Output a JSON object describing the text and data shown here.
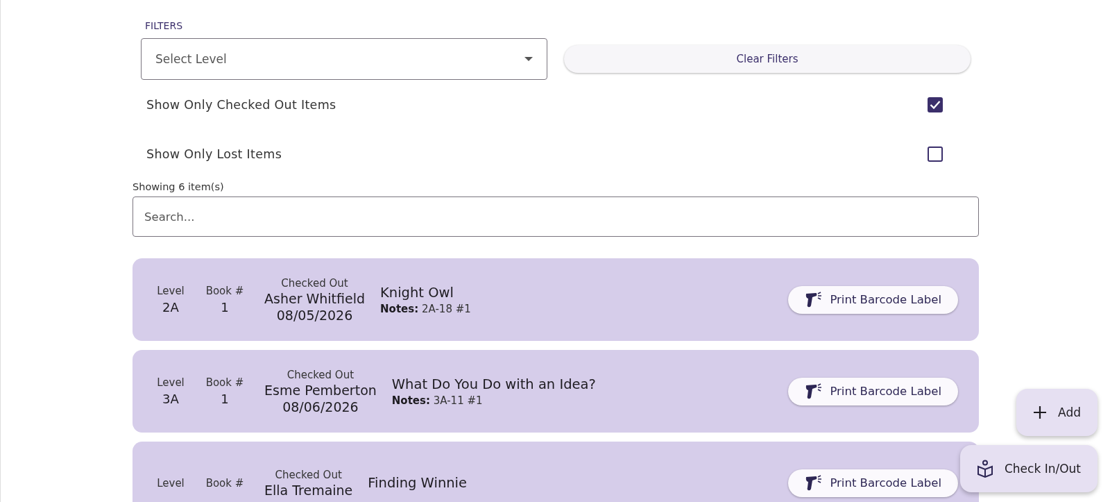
{
  "filters": {
    "heading": "FILTERS",
    "level_select": {
      "placeholder": "Select Level"
    },
    "clear_button": "Clear Filters",
    "toggles": [
      {
        "label": "Show Only Checked Out Items",
        "checked": true
      },
      {
        "label": "Show Only Lost Items",
        "checked": false
      }
    ]
  },
  "count": "Showing 6 item(s)",
  "search": {
    "placeholder": "Search..."
  },
  "items": [
    {
      "level_label": "Level",
      "level": "2A",
      "book_label": "Book #",
      "book": "1",
      "status": "Checked Out",
      "borrower": "Asher Whitfield",
      "date": "08/05/2026",
      "title": "Knight Owl",
      "notes": "**Notes:** 2A-18 #1",
      "button": "Print Barcode Label"
    },
    {
      "level_label": "Level",
      "level": "3A",
      "book_label": "Book #",
      "book": "1",
      "status": "Checked Out",
      "borrower": "Esme Pemberton",
      "date": "08/06/2026",
      "title": "What Do You Do with an Idea?",
      "notes": "**Notes:** 3A-11 #1",
      "button": "Print Barcode Label"
    },
    {
      "level_label": "Level",
      "book_label": "Book #",
      "status": "Checked Out",
      "borrower": "Ella Tremaine",
      "title": "Finding Winnie",
      "button": "Print Barcode Label"
    }
  ],
  "fabs": [
    {
      "kind": "add",
      "label": "Add"
    },
    {
      "kind": "checkinout",
      "label": "Check In/Out"
    }
  ]
}
